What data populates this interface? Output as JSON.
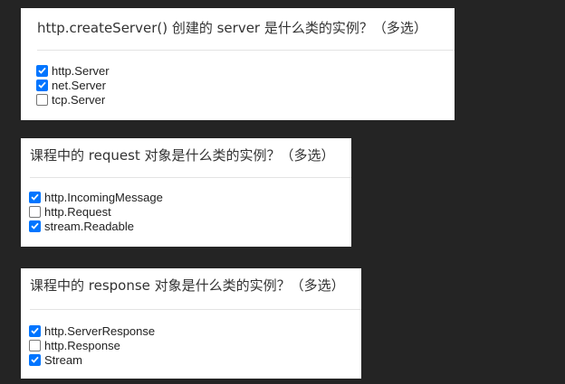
{
  "questions": [
    {
      "title": "http.createServer() 创建的 server 是什么类的实例？（多选）",
      "options": [
        {
          "label": "http.Server",
          "checked": true
        },
        {
          "label": "net.Server",
          "checked": true
        },
        {
          "label": "tcp.Server",
          "checked": false
        }
      ]
    },
    {
      "title": "课程中的 request 对象是什么类的实例？（多选）",
      "options": [
        {
          "label": "http.IncomingMessage",
          "checked": true
        },
        {
          "label": "http.Request",
          "checked": false
        },
        {
          "label": "stream.Readable",
          "checked": true
        }
      ]
    },
    {
      "title": "课程中的 response 对象是什么类的实例？（多选）",
      "options": [
        {
          "label": "http.ServerResponse",
          "checked": true
        },
        {
          "label": "http.Response",
          "checked": false
        },
        {
          "label": "Stream",
          "checked": true
        }
      ]
    }
  ],
  "colors": {
    "page_background": "#242424",
    "card_background": "#ffffff",
    "checkbox_checked": "#0075ff"
  }
}
